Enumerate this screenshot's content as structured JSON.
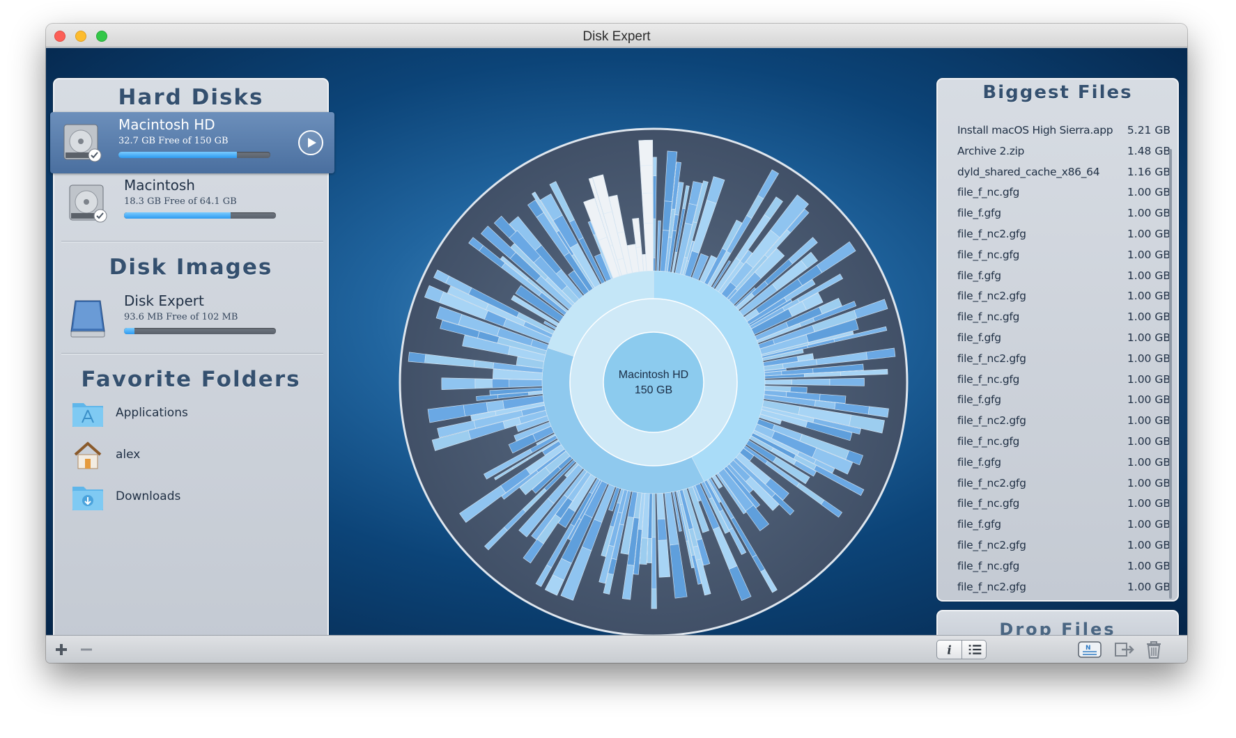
{
  "window": {
    "title": "Disk Expert"
  },
  "sidebar": {
    "hard_disks_title": "Hard Disks",
    "hard_disks": [
      {
        "name": "Macintosh HD",
        "free": "32.7 GB Free of 150 GB",
        "used_fraction": 0.78,
        "selected": true
      },
      {
        "name": "Macintosh",
        "free": "18.3 GB Free of 64.1 GB",
        "used_fraction": 0.7,
        "selected": false
      }
    ],
    "disk_images_title": "Disk Images",
    "disk_images": [
      {
        "name": "Disk Expert",
        "free": "93.6 MB Free of 102 MB",
        "used_fraction": 0.07
      }
    ],
    "favorite_folders_title": "Favorite Folders",
    "favorite_folders": [
      {
        "label": "Applications",
        "icon": "applications-folder-icon"
      },
      {
        "label": "alex",
        "icon": "home-icon"
      },
      {
        "label": "Downloads",
        "icon": "downloads-folder-icon"
      }
    ]
  },
  "chart": {
    "center_name": "Macintosh HD",
    "center_size": "150 GB"
  },
  "biggest_files": {
    "title": "Biggest Files",
    "files": [
      {
        "name": "Install macOS High Sierra.app",
        "size": "5.21 GB"
      },
      {
        "name": "Archive 2.zip",
        "size": "1.48 GB"
      },
      {
        "name": "dyld_shared_cache_x86_64",
        "size": "1.16 GB"
      },
      {
        "name": "file_f_nc.gfg",
        "size": "1.00 GB"
      },
      {
        "name": "file_f.gfg",
        "size": "1.00 GB"
      },
      {
        "name": "file_f_nc2.gfg",
        "size": "1.00 GB"
      },
      {
        "name": "file_f_nc.gfg",
        "size": "1.00 GB"
      },
      {
        "name": "file_f.gfg",
        "size": "1.00 GB"
      },
      {
        "name": "file_f_nc2.gfg",
        "size": "1.00 GB"
      },
      {
        "name": "file_f_nc.gfg",
        "size": "1.00 GB"
      },
      {
        "name": "file_f.gfg",
        "size": "1.00 GB"
      },
      {
        "name": "file_f_nc2.gfg",
        "size": "1.00 GB"
      },
      {
        "name": "file_f_nc.gfg",
        "size": "1.00 GB"
      },
      {
        "name": "file_f.gfg",
        "size": "1.00 GB"
      },
      {
        "name": "file_f_nc2.gfg",
        "size": "1.00 GB"
      },
      {
        "name": "file_f_nc.gfg",
        "size": "1.00 GB"
      },
      {
        "name": "file_f.gfg",
        "size": "1.00 GB"
      },
      {
        "name": "file_f_nc2.gfg",
        "size": "1.00 GB"
      },
      {
        "name": "file_f_nc.gfg",
        "size": "1.00 GB"
      },
      {
        "name": "file_f.gfg",
        "size": "1.00 GB"
      },
      {
        "name": "file_f_nc2.gfg",
        "size": "1.00 GB"
      },
      {
        "name": "file_f_nc.gfg",
        "size": "1.00 GB"
      },
      {
        "name": "file_f_nc2.gfg",
        "size": "1.00 GB"
      }
    ]
  },
  "drop_files": {
    "label": "Drop Files"
  },
  "toolbar": {
    "buttons": [
      "add-icon",
      "remove-icon",
      "info-icon",
      "list-icon",
      "notes-icon",
      "move-icon",
      "trash-icon"
    ]
  },
  "colors": {
    "accent_blue": "#2e9af0",
    "background_dark": "#0c4478",
    "panel": "#cdd3db",
    "title_text": "#34506f"
  }
}
